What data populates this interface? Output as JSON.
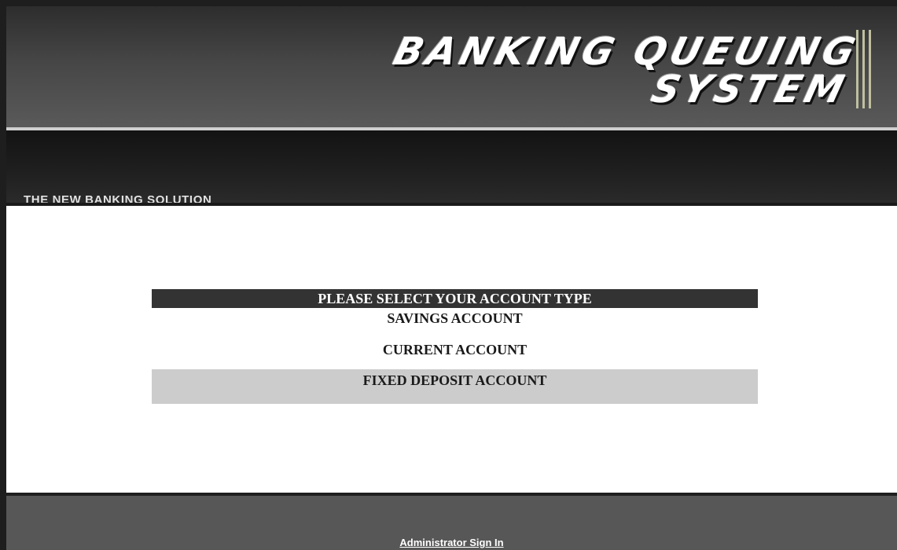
{
  "header": {
    "logo_line1": "BANKING QUEUING",
    "logo_line2": "SYSTEM",
    "tagline": "THE NEW BANKING SOLUTION"
  },
  "account_select": {
    "title": "PLEASE SELECT YOUR ACCOUNT TYPE",
    "options": [
      {
        "label": "SAVINGS ACCOUNT"
      },
      {
        "label": "CURRENT ACCOUNT"
      },
      {
        "label": "FIXED DEPOSIT ACCOUNT",
        "highlighted": true
      }
    ]
  },
  "footer": {
    "admin_link": "Administrator Sign In"
  },
  "colors": {
    "header_dark": "#2d2d2d",
    "nav_dark": "#1f1f1f",
    "title_bar": "#333333",
    "highlight_row": "#cccccc",
    "footer_bg": "#575757"
  }
}
